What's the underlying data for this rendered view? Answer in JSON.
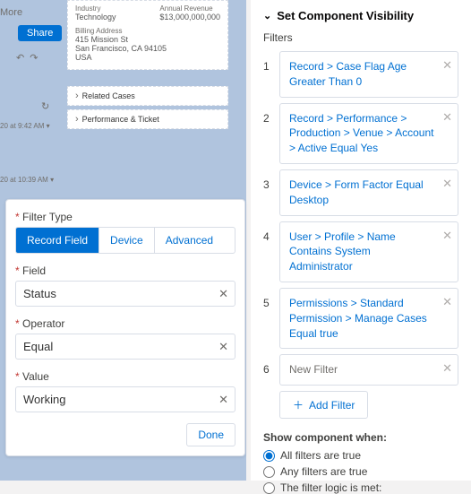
{
  "left": {
    "more_label": "More",
    "share_label": "Share",
    "preview": {
      "industry_label": "Industry",
      "industry_value": "Technology",
      "revenue_label": "Annual Revenue",
      "revenue_value": "$13,000,000,000",
      "billing_label": "Billing Address",
      "billing_line1": "415 Mission St",
      "billing_line2": "San Francisco, CA 94105",
      "billing_line3": "USA",
      "section1": "Related Cases",
      "section2": "Performance & Ticket"
    },
    "timestamp1": "20 at 9:42 AM",
    "timestamp2": "20 at 10:39 AM"
  },
  "filter_card": {
    "type_label": "Filter Type",
    "tabs": {
      "record_field": "Record Field",
      "device": "Device",
      "advanced": "Advanced"
    },
    "field_label": "Field",
    "field_value": "Status",
    "operator_label": "Operator",
    "operator_value": "Equal",
    "value_label": "Value",
    "value_value": "Working",
    "done_label": "Done"
  },
  "right": {
    "panel_title": "Set Component Visibility",
    "filters_label": "Filters",
    "filters": [
      "Record > Case Flag Age Greater Than 0",
      "Record > Performance > Production > Venue > Account > Active Equal Yes",
      "Device > Form Factor Equal Desktop",
      "User > Profile > Name Contains System Administrator",
      "Permissions > Standard Permission > Manage Cases Equal true",
      "New Filter"
    ],
    "add_filter_label": "Add Filter",
    "show_when_label": "Show component when:",
    "radios": {
      "all": "All filters are true",
      "any": "Any filters are true",
      "logic": "The filter logic is met:"
    }
  }
}
